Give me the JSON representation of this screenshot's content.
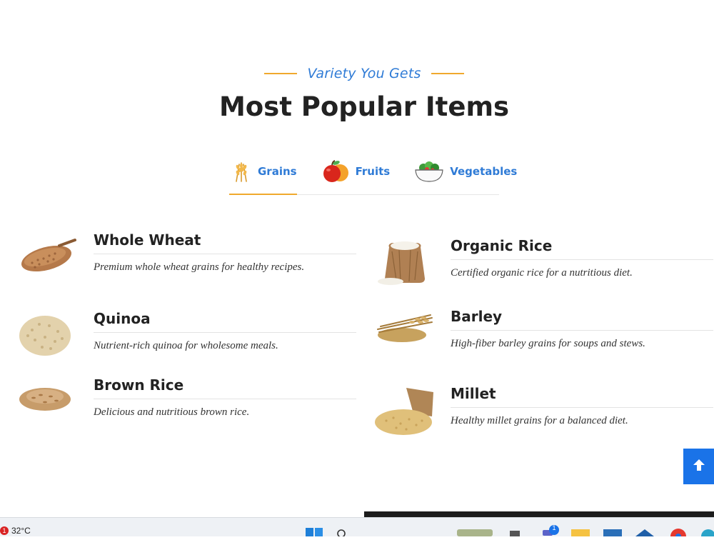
{
  "section": {
    "subtitle": "Variety You Gets",
    "title": "Most Popular Items"
  },
  "tabs": [
    {
      "label": "Grains",
      "icon": "wheat-icon",
      "active": true
    },
    {
      "label": "Fruits",
      "icon": "fruits-icon",
      "active": false
    },
    {
      "label": "Vegetables",
      "icon": "vegetables-bowl-icon",
      "active": false
    }
  ],
  "items": [
    {
      "name": "Whole Wheat",
      "description": "Premium whole wheat grains for healthy recipes.",
      "icon": "whole-wheat-image"
    },
    {
      "name": "Organic Rice",
      "description": "Certified organic rice for a nutritious diet.",
      "icon": "organic-rice-image"
    },
    {
      "name": "Quinoa",
      "description": "Nutrient-rich quinoa for wholesome meals.",
      "icon": "quinoa-image"
    },
    {
      "name": "Barley",
      "description": "High-fiber barley grains for soups and stews.",
      "icon": "barley-image"
    },
    {
      "name": "Brown Rice",
      "description": "Delicious and nutritious brown rice.",
      "icon": "brown-rice-image"
    },
    {
      "name": "Millet",
      "description": "Healthy millet grains for a balanced diet.",
      "icon": "millet-image"
    }
  ],
  "scroll_top": {
    "icon": "arrow-up-icon"
  },
  "taskbar": {
    "weather_badge": "1",
    "temperature": "32°C",
    "notification_count": "1"
  },
  "colors": {
    "accent_blue": "#2f7bd6",
    "accent_orange": "#f0a92e",
    "button_blue": "#1a73e8"
  }
}
